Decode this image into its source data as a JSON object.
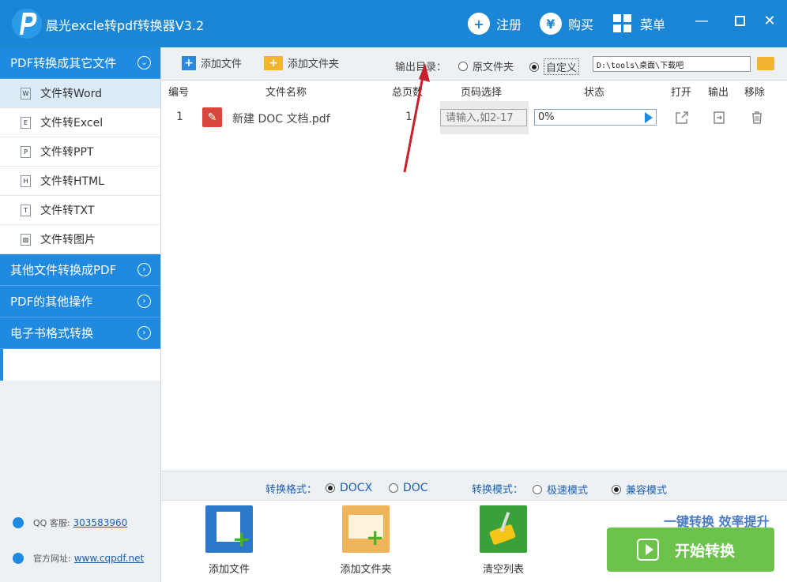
{
  "app": {
    "title": "晨光excle转pdf转换器V3.2"
  },
  "titlebar": {
    "register": "注册",
    "buy": "购买",
    "menu": "菜单"
  },
  "sidebar": {
    "sections": [
      {
        "label": "PDF转换成其它文件"
      },
      {
        "label": "其他文件转换成PDF"
      },
      {
        "label": "PDF的其他操作"
      },
      {
        "label": "电子书格式转换"
      }
    ],
    "items": [
      {
        "label": "文件转Word",
        "icon": "W"
      },
      {
        "label": "文件转Excel",
        "icon": "E"
      },
      {
        "label": "文件转PPT",
        "icon": "P"
      },
      {
        "label": "文件转HTML",
        "icon": "H"
      },
      {
        "label": "文件转TXT",
        "icon": "T"
      },
      {
        "label": "文件转图片",
        "icon": "img"
      }
    ],
    "qq_label": "QQ 客服:",
    "qq_value": "303583960",
    "site_label": "官方网址:",
    "site_value": "www.cqpdf.net"
  },
  "toolbar": {
    "add_file": "添加文件",
    "add_folder": "添加文件夹",
    "output_dir_label": "输出目录：",
    "opt_original": "原文件夹",
    "opt_custom": "自定义",
    "output_path": "D:\\tools\\桌面\\下载吧"
  },
  "table": {
    "headers": [
      "编号",
      "文件名称",
      "总页数",
      "页码选择",
      "状态",
      "打开",
      "输出",
      "移除"
    ],
    "rows": [
      {
        "index": "1",
        "name": "新建 DOC 文档.pdf",
        "pages": "1",
        "page_placeholder": "请输入,如2-17",
        "status": "0%"
      }
    ]
  },
  "options": {
    "format_label": "转换格式：",
    "format_docx": "DOCX",
    "format_doc": "DOC",
    "mode_label": "转换模式：",
    "mode_fast": "极速模式",
    "mode_compat": "兼容模式"
  },
  "actions": {
    "add_file": "添加文件",
    "add_folder": "添加文件夹",
    "clear_list": "清空列表",
    "slogan": "一键转换  效率提升",
    "start": "开始转换"
  }
}
